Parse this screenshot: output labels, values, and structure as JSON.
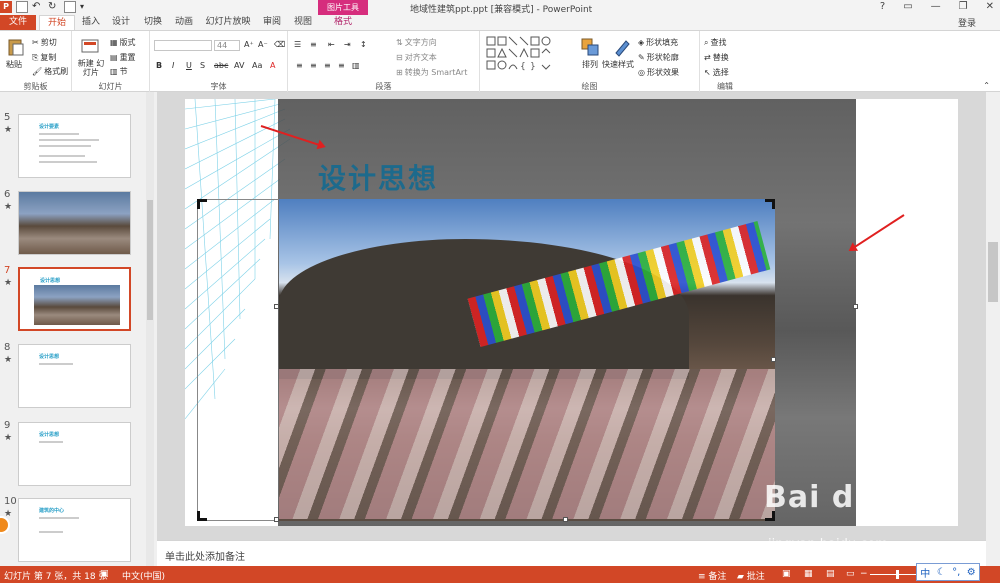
{
  "window": {
    "title": "地域性建筑ppt.ppt [兼容模式] - PowerPoint",
    "contextual_tab_group": "图片工具",
    "login": "登录",
    "controls": [
      "?",
      "▭",
      "—",
      "❐",
      "✕"
    ]
  },
  "tabs": [
    {
      "label": "文件"
    },
    {
      "label": "开始"
    },
    {
      "label": "插入"
    },
    {
      "label": "设计"
    },
    {
      "label": "切换"
    },
    {
      "label": "动画"
    },
    {
      "label": "幻灯片放映"
    },
    {
      "label": "审阅"
    },
    {
      "label": "视图"
    },
    {
      "label": "格式"
    }
  ],
  "ribbon": {
    "clipboard": {
      "label": "剪贴板",
      "paste": "粘贴",
      "cut": "剪切",
      "copy": "复制",
      "format_painter": "格式刷"
    },
    "slides": {
      "label": "幻灯片",
      "new_slide": "新建\n幻灯片",
      "layout": "版式",
      "reset": "重置",
      "section": "节"
    },
    "font": {
      "label": "字体",
      "size": "44"
    },
    "paragraph": {
      "label": "段落",
      "text_direction": "文字方向",
      "align_text": "对齐文本",
      "smartart": "转换为 SmartArt"
    },
    "drawing": {
      "label": "绘图",
      "arrange": "排列",
      "quick_styles": "快速样式",
      "shape_fill": "形状填充",
      "shape_outline": "形状轮廓",
      "shape_effects": "形状效果"
    },
    "editing": {
      "label": "编辑",
      "find": "查找",
      "replace": "替换",
      "select": "选择"
    }
  },
  "slides_panel": [
    {
      "num": "5",
      "star": "★",
      "title": "设计要素"
    },
    {
      "num": "6",
      "star": "★",
      "title": ""
    },
    {
      "num": "7",
      "star": "★",
      "title": "设计思想"
    },
    {
      "num": "8",
      "star": "★",
      "title": "设计思想"
    },
    {
      "num": "9",
      "star": "★",
      "title": "设计思想"
    },
    {
      "num": "10",
      "star": "★",
      "title": "建筑的中心"
    }
  ],
  "slide": {
    "title": "设计思想"
  },
  "notes": {
    "placeholder": "单击此处添加备注"
  },
  "status": {
    "slide_info": "幻灯片 第 7 张，共 18 张",
    "language": "中文(中国)",
    "notes_btn": "备注",
    "comments_btn": "批注"
  },
  "ime": {
    "lang": "中"
  },
  "watermark": {
    "brand": "Bai du 经验",
    "url": "jingyan.baidu.com"
  },
  "colors": {
    "accent": "#d24726",
    "context": "#d62d7d",
    "title_blue": "#1d6a8c"
  }
}
